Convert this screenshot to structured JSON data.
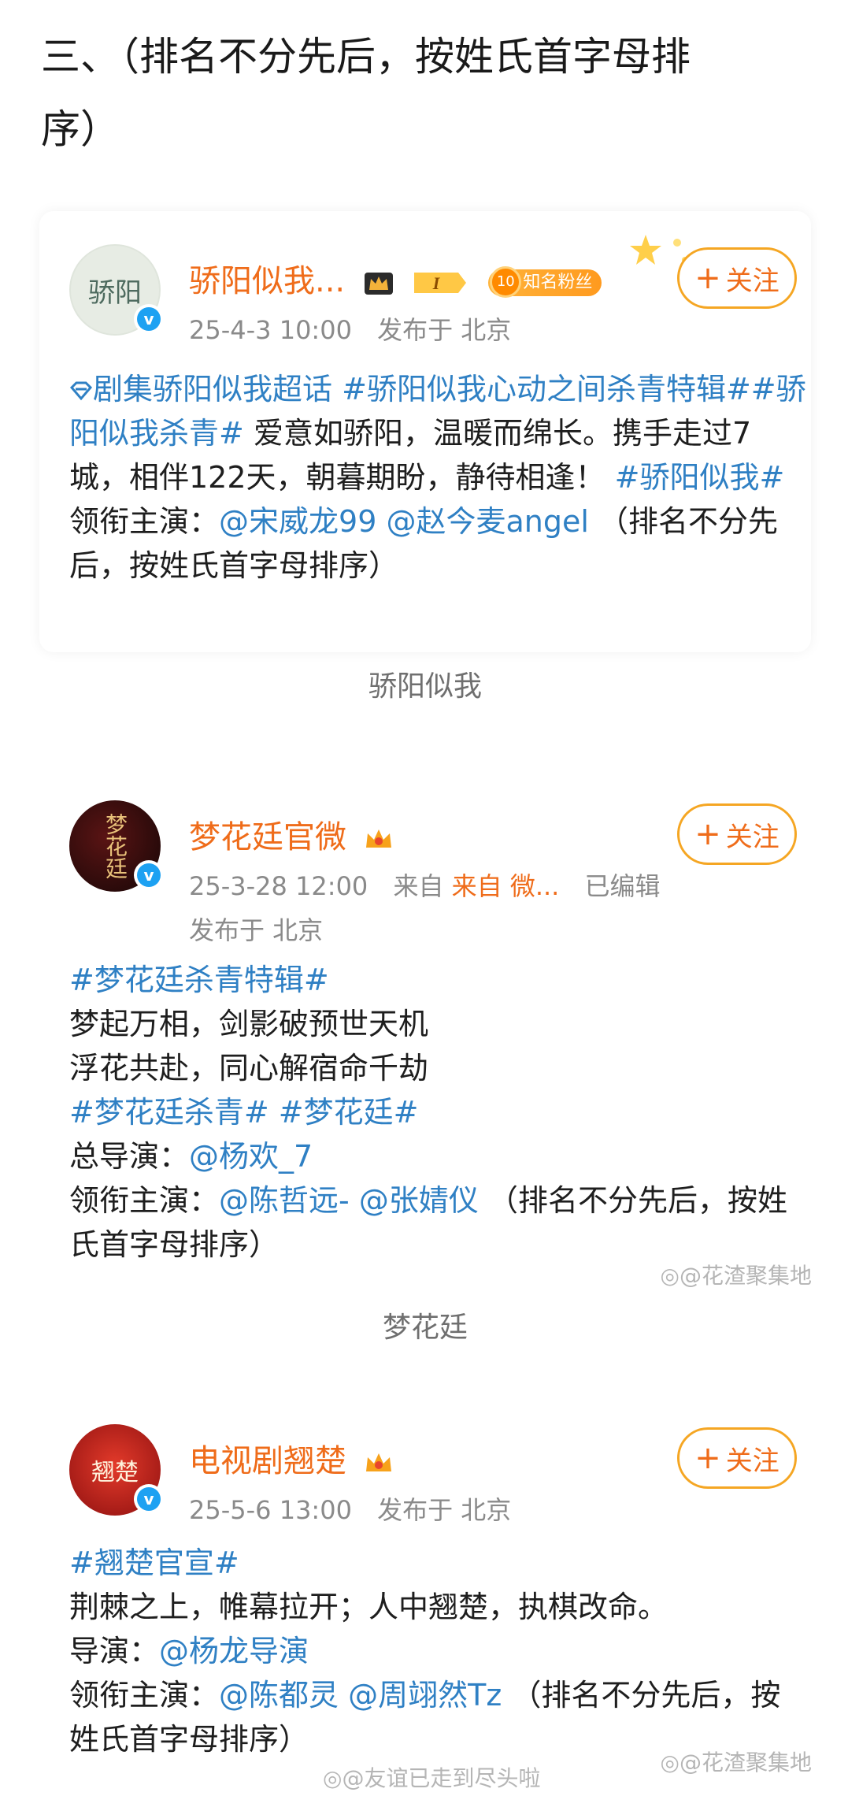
{
  "heading": {
    "line1": "三、（排名不分先后，按姓氏首字母排",
    "line2": "序）"
  },
  "follow_label": "关注",
  "follow_plus": "+",
  "posts": [
    {
      "username": "骄阳似我...",
      "level": "I",
      "fan_level": "10",
      "fan_badge": "知名粉丝",
      "avatar_text": "骄阳",
      "time": "25-4-3 10:00",
      "location": "发布于 北京",
      "supertopic": "剧集骄阳似我超话",
      "tag1": "#骄阳似我心动之间杀青特辑#",
      "tag2": "#骄阳似我杀青#",
      "text1": "爱意如骄阳，温暖而绵长。携手走过7城，相伴122天，朝暮期盼，静待相逢！",
      "tag3": "#骄阳似我#",
      "lead_label": "领衔主演：",
      "mention1": "@宋威龙99",
      "mention2": "@赵今麦angel",
      "note": "（排名不分先后，按姓氏首字母排序）",
      "caption": "骄阳似我"
    },
    {
      "username": "梦花廷官微",
      "avatar_text": "梦花廷",
      "time": "25-3-28 12:00",
      "source": "来自 微...",
      "edited": "已编辑",
      "location": "发布于 北京",
      "tag1": "#梦花廷杀青特辑#",
      "line1": "梦起万相，剑影破预世天机",
      "line2": "浮花共赴，同心解宿命千劫",
      "tag2": "#梦花廷杀青#",
      "tag3": "#梦花廷#",
      "director_label": "总导演：",
      "director": "@杨欢_7",
      "lead_label": "领衔主演：",
      "mention1": "@陈哲远-",
      "mention2": "@张婧仪",
      "note": "（排名不分先后，按姓氏首字母排序）",
      "caption": "梦花廷",
      "watermark": "@花渣聚集地"
    },
    {
      "username": "电视剧翘楚",
      "avatar_text": "翘楚",
      "time": "25-5-6 13:00",
      "location": "发布于 北京",
      "tag1": "#翘楚官宣#",
      "line1": "荆棘之上，帷幕拉开；人中翘楚，执棋改命。",
      "director_label": "导演：",
      "director": "@杨龙导演",
      "lead_label": "领衔主演：",
      "mention1": "@陈都灵",
      "mention2": "@周翊然Tz",
      "note": "（排名不分先后，按姓氏首字母排序）",
      "watermark_left": "@友谊已走到尽头啦",
      "watermark_right": "@花渣聚集地"
    }
  ],
  "colors": {
    "accent": "#ef6c1a",
    "link": "#2f80c4",
    "follow_border": "#f5a623",
    "verified": "#1da1f2"
  }
}
